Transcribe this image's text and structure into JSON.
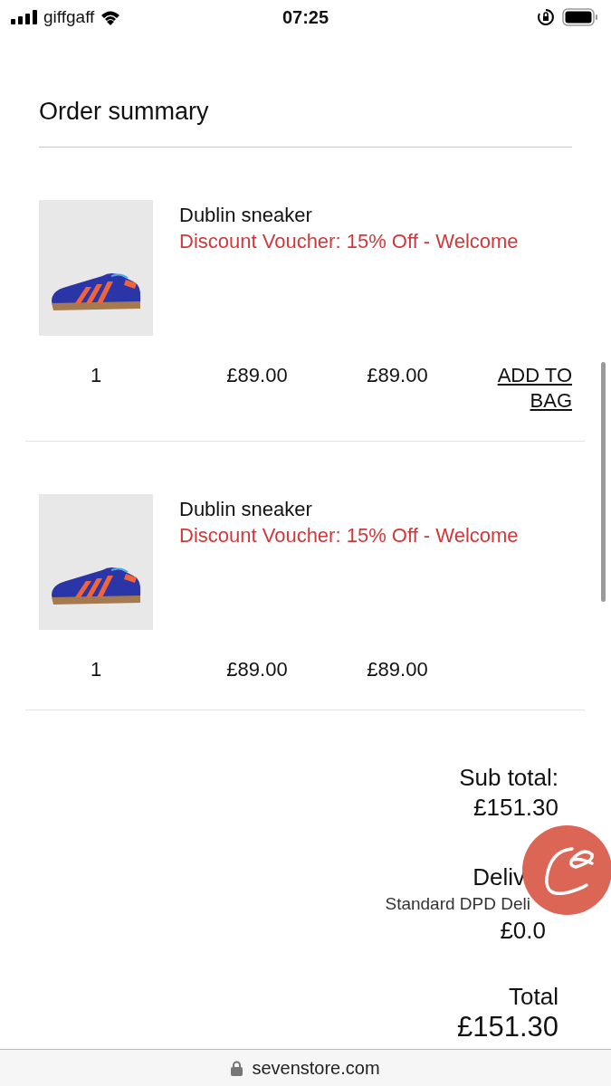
{
  "status_bar": {
    "carrier": "giffgaff",
    "time": "07:25"
  },
  "title": "Order summary",
  "items": [
    {
      "name": "Dublin sneaker",
      "discount": "Discount Voucher: 15% Off - Welcome",
      "quantity": "1",
      "price": "£89.00",
      "total": "£89.00",
      "action": "ADD TO BAG"
    },
    {
      "name": "Dublin sneaker",
      "discount": "Discount Voucher: 15% Off - Welcome",
      "quantity": "1",
      "price": "£89.00",
      "total": "£89.00"
    }
  ],
  "totals": {
    "subtotal_label": "Sub total:",
    "subtotal": "£151.30",
    "delivery_label": "Deliv",
    "delivery_method": "Standard DPD Deli",
    "delivery_cost": "£0.0",
    "total_label": "Total",
    "total": "£151.30"
  },
  "url": "sevenstore.com"
}
